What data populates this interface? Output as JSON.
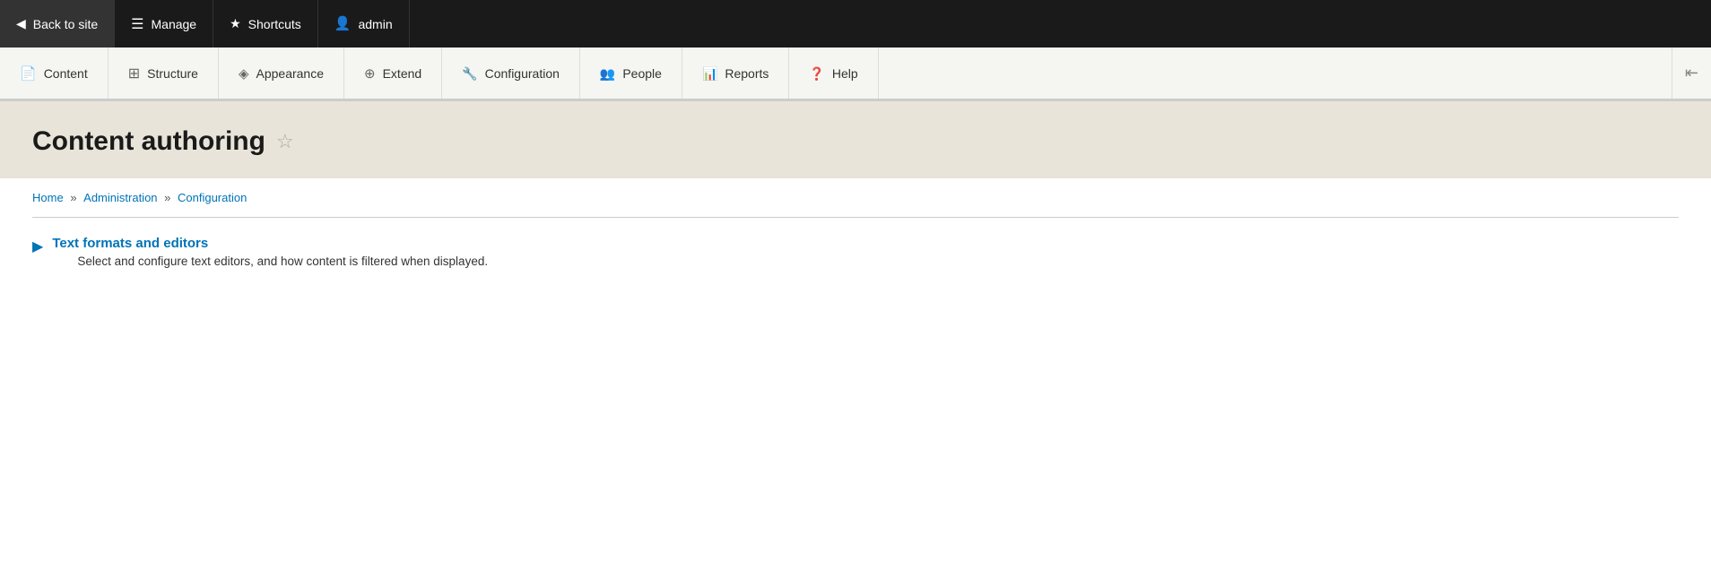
{
  "admin_bar": {
    "back_to_site": "Back to site",
    "manage": "Manage",
    "shortcuts": "Shortcuts",
    "admin": "admin"
  },
  "main_nav": {
    "items": [
      {
        "id": "content",
        "label": "Content"
      },
      {
        "id": "structure",
        "label": "Structure"
      },
      {
        "id": "appearance",
        "label": "Appearance"
      },
      {
        "id": "extend",
        "label": "Extend"
      },
      {
        "id": "configuration",
        "label": "Configuration"
      },
      {
        "id": "people",
        "label": "People"
      },
      {
        "id": "reports",
        "label": "Reports"
      },
      {
        "id": "help",
        "label": "Help"
      }
    ]
  },
  "page": {
    "title": "Content authoring",
    "breadcrumb": {
      "home": "Home",
      "administration": "Administration",
      "configuration": "Configuration"
    },
    "sections": [
      {
        "id": "text-formats",
        "title": "Text formats and editors",
        "description": "Select and configure text editors, and how content is filtered when displayed."
      }
    ]
  }
}
